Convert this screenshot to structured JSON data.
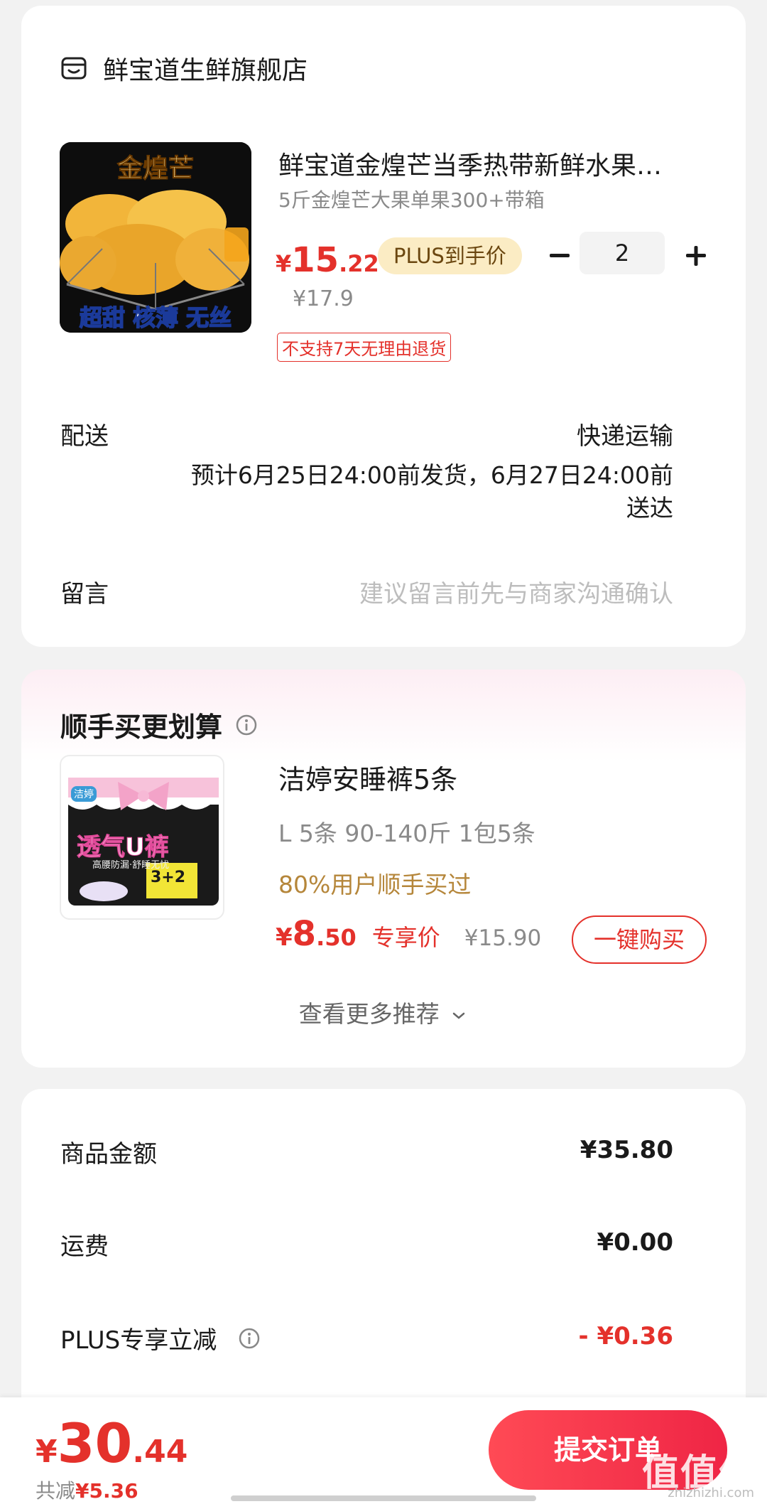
{
  "store": {
    "name": "鲜宝道生鲜旗舰店",
    "icon": "store-icon"
  },
  "product": {
    "image_text_top": "金煌芒",
    "image_text_bottom": "超甜 核薄 无丝",
    "title": "鲜宝道金煌芒当季热带新鲜水果…",
    "sku": "5斤金煌芒大果单果300+带箱",
    "price_yen": "¥",
    "price_int": "15",
    "price_dec": ".22",
    "plus_badge": "PLUS到手价",
    "original_price": "¥17.9",
    "return_tag": "不支持7天无理由退货",
    "quantity": "2"
  },
  "delivery": {
    "label": "配送",
    "method": "快递运输",
    "detail_line1": "预计6月25日24:00前发货，6月27日24:00前",
    "detail_line2": "送达"
  },
  "remark": {
    "label": "留言",
    "placeholder": "建议留言前先与商家沟通确认"
  },
  "recommend": {
    "title": "顺手买更划算",
    "image_brand": "洁婷",
    "image_text": "透气U裤",
    "image_sub": "高腰防漏·舒睡无忧",
    "image_promo": "3+2",
    "name": "洁婷安睡裤5条",
    "spec": "L 5条 90-140斤   1包5条",
    "social": "80%用户顺手买过",
    "price_yen": "¥",
    "price_int": "8",
    "price_dec": ".50",
    "price_tag": "专享价",
    "original_price": "¥15.90",
    "buy_label": "一键购买",
    "more_label": "查看更多推荐"
  },
  "summary": {
    "goods_label": "商品金额",
    "goods_value": "¥35.80",
    "shipping_label": "运费",
    "shipping_value": "¥0.00",
    "plus_label": "PLUS专享立减",
    "plus_value": "- ¥0.36"
  },
  "footer": {
    "total_yen": "¥",
    "total_int": "30",
    "total_dec": ".44",
    "saved_label": "共减",
    "saved_amount": "¥5.36",
    "submit_label": "提交订单",
    "watermark": "值值值",
    "watermark_sub": "zhizhizhi.com"
  },
  "colors": {
    "accent_red": "#e4312b",
    "plus_gold_bg": "#fbecc4",
    "submit_gradient_start": "#ff4a55",
    "submit_gradient_end": "#ef2545"
  }
}
